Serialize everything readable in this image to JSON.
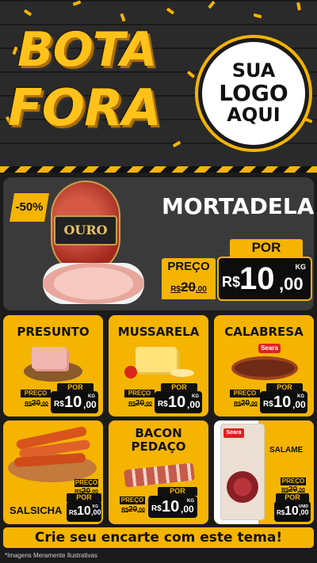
{
  "header": {
    "title_line1": "BOTA",
    "title_line2": "FORA",
    "logo_line1": "SUA",
    "logo_line2": "LOGO",
    "logo_line3": "AQUI"
  },
  "featured": {
    "name": "MORTADELA",
    "brand_label": "OURO",
    "discount": "-50%",
    "por_label": "POR",
    "preco_label": "PREÇO",
    "old_prefix": "R$",
    "old_int": "20",
    "old_dec": ",00",
    "currency": "R$",
    "new_int": "10",
    "new_dec": ",00",
    "unit": "KG"
  },
  "products": [
    {
      "name": "PRESUNTO",
      "por": "POR",
      "preco": "PREÇO",
      "old_prefix": "R$",
      "old_int": "20",
      "old_dec": ",00",
      "currency": "R$",
      "new_int": "10",
      "new_dec": ",00",
      "unit": "KG"
    },
    {
      "name": "MUSSARELA",
      "por": "POR",
      "preco": "PREÇO",
      "old_prefix": "R$",
      "old_int": "20",
      "old_dec": ",00",
      "currency": "R$",
      "new_int": "10",
      "new_dec": ",00",
      "unit": "KG"
    },
    {
      "name": "CALABRESA",
      "brand_label": "Seara",
      "por": "POR",
      "preco": "PREÇO",
      "old_prefix": "R$",
      "old_int": "20",
      "old_dec": ",00",
      "currency": "R$",
      "new_int": "10",
      "new_dec": ",00",
      "unit": "KG"
    },
    {
      "name": "SALSICHA",
      "por": "POR",
      "preco": "PREÇO",
      "old_prefix": "R$",
      "old_int": "20",
      "old_dec": ",00",
      "currency": "R$",
      "new_int": "10",
      "new_dec": ",00",
      "unit": "KG"
    },
    {
      "name_line1": "BACON",
      "name_line2": "PEDAÇO",
      "por": "POR",
      "preco": "PREÇO",
      "old_prefix": "R$",
      "old_int": "20",
      "old_dec": ",00",
      "currency": "R$",
      "new_int": "10",
      "new_dec": ",00",
      "unit": "KG"
    },
    {
      "name": "SALAME",
      "brand_label": "Seara",
      "por": "POR",
      "preco": "PREÇO",
      "old_prefix": "R$",
      "old_int": "20",
      "old_dec": ",00",
      "currency": "R$",
      "new_int": "10",
      "new_dec": ",00",
      "unit": "UNID"
    }
  ],
  "cta": "Crie seu encarte com este tema!",
  "disclaimer": "*Imagens Meramente Ilustrativas",
  "colors": {
    "accent": "#f4b400",
    "dark": "#1b1b1b",
    "card": "#3a3a3a"
  }
}
